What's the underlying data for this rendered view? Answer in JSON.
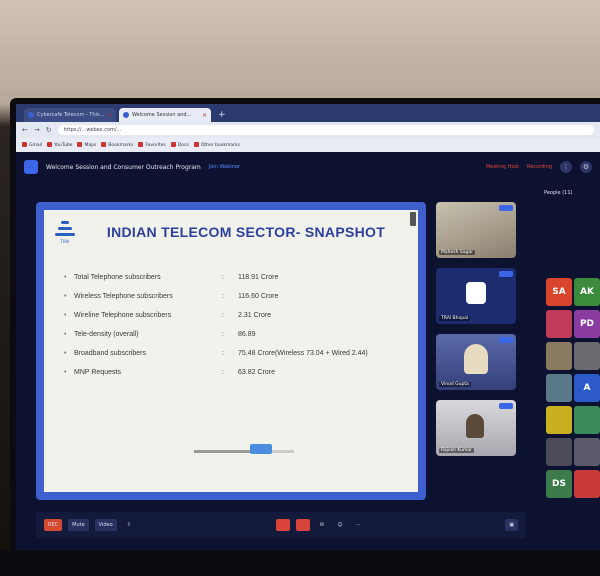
{
  "browser": {
    "tabs": [
      {
        "label": "Cybercafe Telecom - This..."
      },
      {
        "label": "Welcome Session and..."
      }
    ],
    "url": "https://...webex.com/...",
    "bookmarks": [
      "Gmail",
      "YouTube",
      "Maps",
      "Bookmarks",
      "Favorites",
      "Docs",
      "Other bookmarks"
    ]
  },
  "meeting": {
    "title": "Welcome Session and Consumer Outreach Program",
    "link": "Join Webinar",
    "status_left": "Meeting Host",
    "status_right": "Recording",
    "people_label": "People (11)"
  },
  "slide": {
    "logo_text": "TRAI",
    "title": "INDIAN TELECOM SECTOR- SNAPSHOT",
    "rows": [
      {
        "key": "Total Telephone subscribers",
        "value": "118.91 Crore"
      },
      {
        "key": "Wireless Telephone subscribers",
        "value": "116.60 Crore"
      },
      {
        "key": "Wireline Telephone subscribers",
        "value": "2.31 Crore"
      },
      {
        "key": "Tele-density (overall)",
        "value": "86.89"
      },
      {
        "key": "Broadband subscribers",
        "value": "75.48 Crore(Wireless 73.04 + Wired 2.44)"
      },
      {
        "key": "MNP Requests",
        "value": "63.82 Crore"
      }
    ]
  },
  "participants": [
    {
      "name": "Mahesh Sagar"
    },
    {
      "name": "TRAI Bhopal"
    },
    {
      "name": "Vinod Gupta"
    },
    {
      "name": "Rajesh Kumar"
    }
  ],
  "grid_initials": [
    "SA",
    "AK",
    "",
    "PD",
    "",
    "",
    "",
    "A",
    "",
    "",
    "",
    "",
    "DS",
    ""
  ],
  "toolbar": {
    "record": "REC",
    "mute": "Mute",
    "video": "Video"
  },
  "colors": {
    "accent": "#3b66e8",
    "slide_title": "#2c3e9e",
    "alert": "#e0443c"
  }
}
